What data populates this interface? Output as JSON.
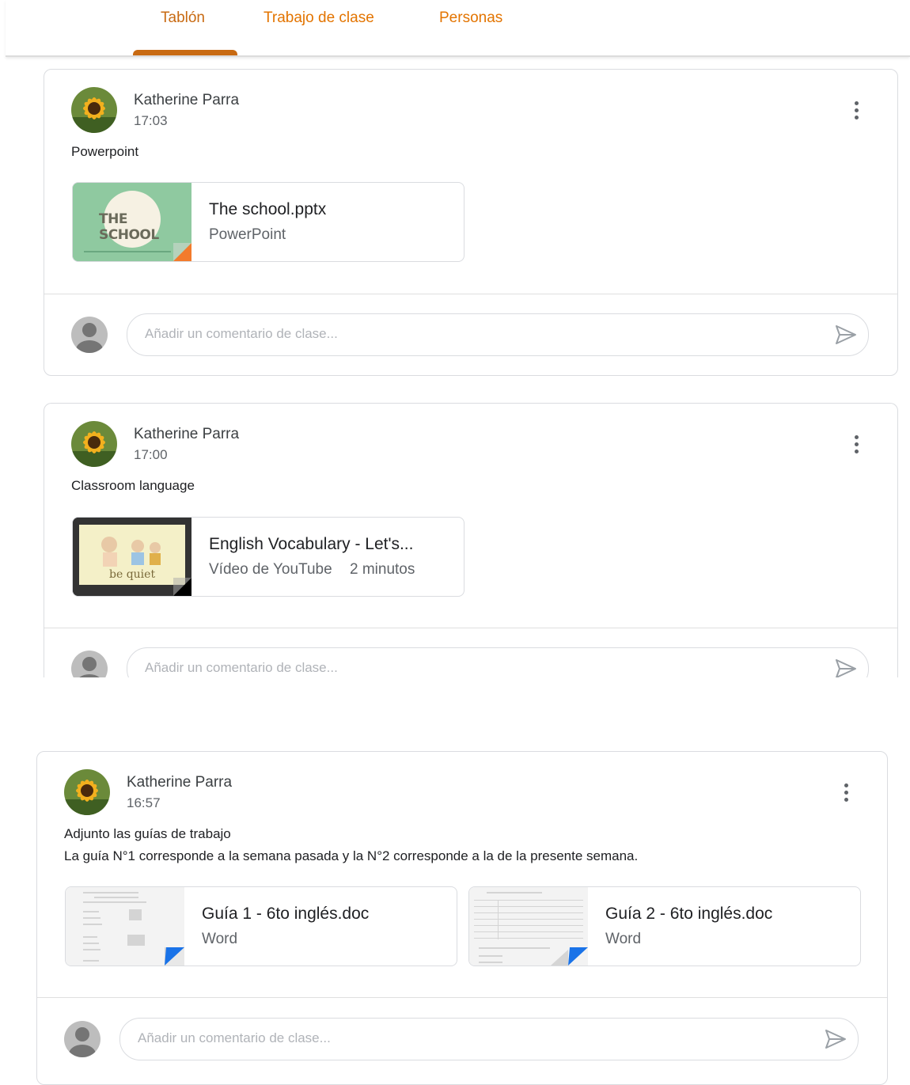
{
  "tabs": [
    {
      "label": "Tablón",
      "active": true
    },
    {
      "label": "Trabajo de clase",
      "active": false
    },
    {
      "label": "Personas",
      "active": false
    }
  ],
  "accent_color": "#e37400",
  "comment_placeholder": "Añadir un comentario de clase...",
  "posts": [
    {
      "author": "Katherine Parra",
      "time": "17:03",
      "text": [
        "Powerpoint"
      ],
      "attachments": [
        {
          "title": "The school.pptx",
          "subtitle": "PowerPoint",
          "thumb_text": "THE SCHOOL",
          "type_color": "#f37b2c"
        }
      ]
    },
    {
      "author": "Katherine Parra",
      "time": "17:00",
      "text": [
        "Classroom language"
      ],
      "attachments": [
        {
          "title": "English Vocabulary - Let's...",
          "subtitle": "Vídeo de YouTube",
          "duration": "2 minutos",
          "thumb_text": "be quiet",
          "type_color": "#202124"
        }
      ]
    },
    {
      "author": "Katherine Parra",
      "time": "16:57",
      "text": [
        "Adjunto las guías de trabajo",
        "La guía N°1 corresponde a la semana pasada y la N°2 corresponde a la de la presente semana."
      ],
      "attachments": [
        {
          "title": "Guía 1 - 6to inglés.doc",
          "subtitle": "Word",
          "type_color": "#1a73e8"
        },
        {
          "title": "Guía 2 - 6to inglés.doc",
          "subtitle": "Word",
          "type_color": "#1a73e8"
        }
      ]
    }
  ]
}
